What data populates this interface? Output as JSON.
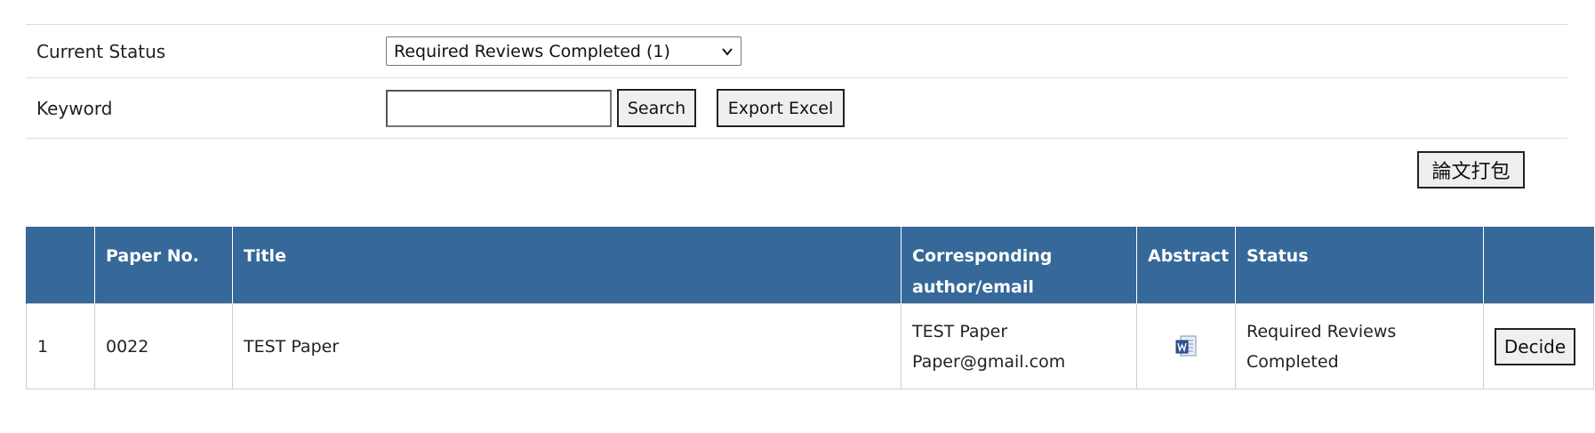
{
  "filters": {
    "status_label": "Current Status",
    "status_value": "Required Reviews Completed (1)",
    "keyword_label": "Keyword",
    "keyword_value": "",
    "search_label": "Search",
    "export_label": "Export Excel"
  },
  "pack_button_label": "論文打包",
  "table": {
    "headers": {
      "index": "",
      "paper_no": "Paper No.",
      "title": "Title",
      "author_line1": "Corresponding",
      "author_line2": "author/email",
      "abstract": "Abstract",
      "status": "Status",
      "action": ""
    },
    "rows": [
      {
        "index": "1",
        "paper_no": "0022",
        "title": "TEST Paper",
        "author_name": "TEST Paper",
        "author_email": "Paper@gmail.com",
        "abstract_icon": "word-document-icon",
        "status_line1": "Required Reviews",
        "status_line2": "Completed",
        "action_label": "Decide"
      }
    ]
  },
  "colors": {
    "header_bg": "#366899",
    "header_text": "#ffffff",
    "border": "#cfcfcf"
  }
}
